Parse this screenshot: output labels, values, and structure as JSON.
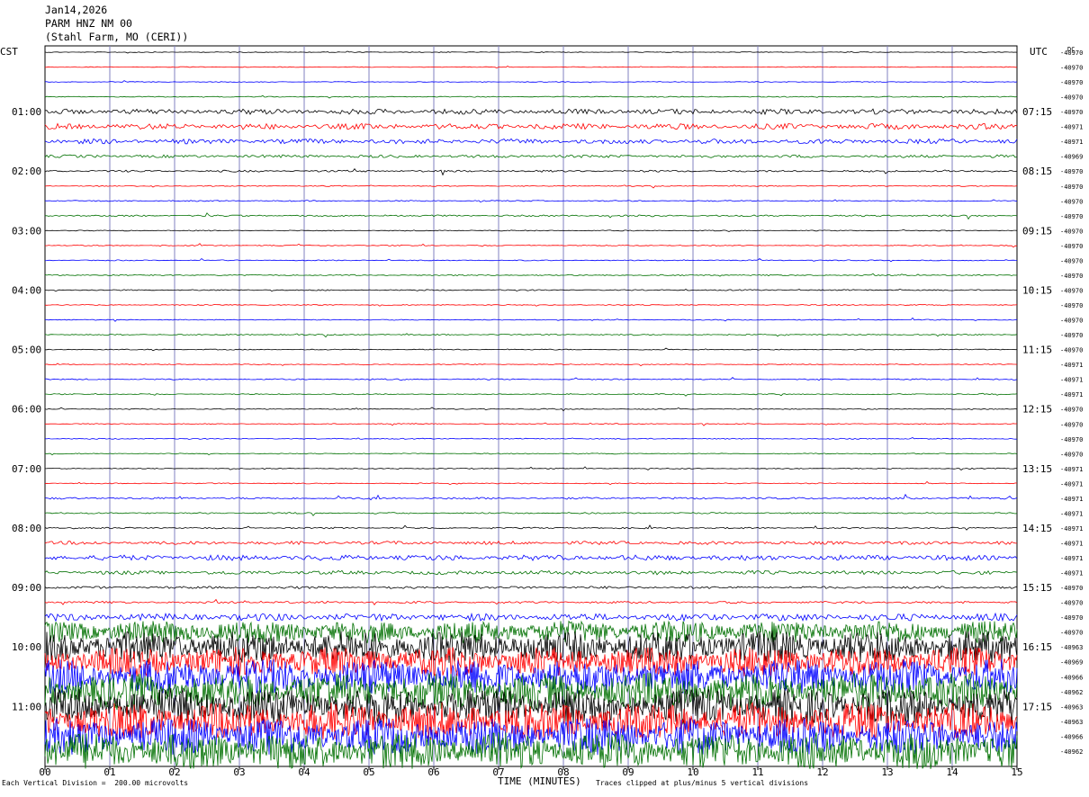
{
  "header": {
    "date": "Jan14,2026",
    "station": "PARM HNZ NM 00",
    "location": "(Stahl Farm, MO (CERI))"
  },
  "left_axis_label": "CST",
  "right_axis_label": "UTC",
  "dc_label": "DC",
  "footer": {
    "scale_note": "Each Vertical Division =  200.00 microvolts",
    "x_title": "TIME (MINUTES)",
    "clip_note": "Traces clipped at plus/minus 5 vertical divisions"
  },
  "colors": {
    "black": "#000000",
    "red": "#ff0000",
    "blue": "#0000ff",
    "green": "#007000",
    "grid": "#8080c0"
  },
  "chart_data": {
    "type": "line",
    "title": "PARM HNZ NM 00",
    "xlabel": "TIME (MINUTES)",
    "xlim": [
      0,
      15
    ],
    "x_ticks": [
      "00",
      "01",
      "02",
      "03",
      "04",
      "05",
      "06",
      "07",
      "08",
      "09",
      "10",
      "11",
      "12",
      "13",
      "14",
      "15"
    ],
    "left_time_labels": [
      {
        "trace": 4,
        "label": "01:00"
      },
      {
        "trace": 8,
        "label": "02:00"
      },
      {
        "trace": 12,
        "label": "03:00"
      },
      {
        "trace": 16,
        "label": "04:00"
      },
      {
        "trace": 20,
        "label": "05:00"
      },
      {
        "trace": 24,
        "label": "06:00"
      },
      {
        "trace": 28,
        "label": "07:00"
      },
      {
        "trace": 32,
        "label": "08:00"
      },
      {
        "trace": 36,
        "label": "09:00"
      },
      {
        "trace": 40,
        "label": "10:00"
      },
      {
        "trace": 44,
        "label": "11:00"
      }
    ],
    "right_time_labels": [
      {
        "trace": 4,
        "label": "07:15"
      },
      {
        "trace": 8,
        "label": "08:15"
      },
      {
        "trace": 12,
        "label": "09:15"
      },
      {
        "trace": 16,
        "label": "10:15"
      },
      {
        "trace": 20,
        "label": "11:15"
      },
      {
        "trace": 24,
        "label": "12:15"
      },
      {
        "trace": 28,
        "label": "13:15"
      },
      {
        "trace": 32,
        "label": "14:15"
      },
      {
        "trace": 36,
        "label": "15:15"
      },
      {
        "trace": 40,
        "label": "16:15"
      },
      {
        "trace": 44,
        "label": "17:15"
      }
    ],
    "trace_colors": [
      "black",
      "red",
      "blue",
      "green"
    ],
    "dc_offsets": [
      "-40970",
      "-40970",
      "-40970",
      "-40970",
      "-40970",
      "-40971",
      "-40971",
      "-40969",
      "-40970",
      "-40970",
      "-40970",
      "-40970",
      "-40970",
      "-40970",
      "-40970",
      "-40970",
      "-40970",
      "-40970",
      "-40970",
      "-40970",
      "-40970",
      "-40971",
      "-40971",
      "-40971",
      "-40970",
      "-40970",
      "-40970",
      "-40970",
      "-40971",
      "-40971",
      "-40971",
      "-40971",
      "-40971",
      "-40971",
      "-40971",
      "-40971",
      "-40970",
      "-40970",
      "-40970",
      "-40970",
      "-40963",
      "-40969",
      "-40966",
      "-40962",
      "-40963",
      "-40963",
      "-40966",
      "-40962"
    ],
    "trace_activity": [
      0.3,
      0.3,
      0.3,
      0.4,
      2.2,
      2.4,
      2.0,
      1.2,
      0.8,
      0.4,
      0.5,
      0.7,
      0.4,
      0.4,
      0.4,
      0.5,
      0.5,
      0.4,
      0.4,
      0.5,
      0.4,
      0.4,
      0.5,
      0.4,
      0.4,
      0.4,
      0.4,
      0.4,
      0.4,
      0.4,
      0.8,
      0.6,
      0.6,
      1.4,
      2.2,
      1.6,
      1.0,
      0.9,
      3.0,
      9.0,
      13,
      12,
      14,
      15,
      15,
      15,
      15,
      15
    ]
  }
}
